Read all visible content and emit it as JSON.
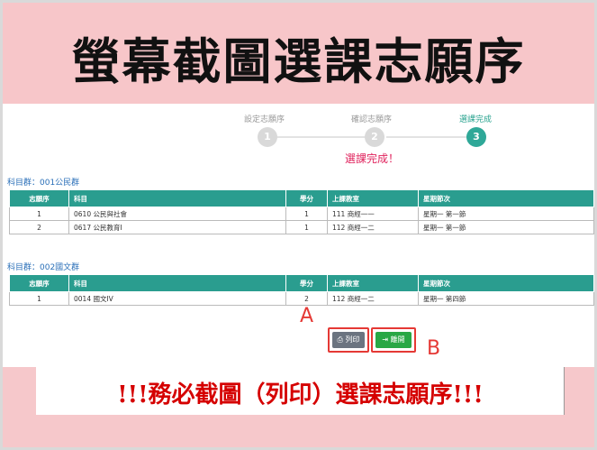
{
  "title": "螢幕截圖選課志願序",
  "steps": [
    {
      "label": "設定志願序",
      "number": "1",
      "active": false
    },
    {
      "label": "確認志願序",
      "number": "2",
      "active": false
    },
    {
      "label": "選課完成",
      "number": "3",
      "active": true
    }
  ],
  "done_message": "選課完成！",
  "columns": [
    "志願序",
    "科目",
    "學分",
    "上課教室",
    "星期節次"
  ],
  "groups": [
    {
      "label": "科目群：001公民群",
      "rows": [
        [
          "1",
          "0610 公民與社會",
          "1",
          "111 商經一一",
          "星期一 第一節"
        ],
        [
          "2",
          "0617 公民教育Ⅰ",
          "1",
          "112 商經一二",
          "星期一 第一節"
        ]
      ]
    },
    {
      "label": "科目群：002國文群",
      "rows": [
        [
          "1",
          "0014 國文IV",
          "2",
          "112 商經一二",
          "星期一 第四節"
        ]
      ]
    }
  ],
  "buttons": {
    "print": "列印",
    "leave": "離開"
  },
  "icons": {
    "print": "printer-icon",
    "leave": "exit-icon"
  },
  "markers": {
    "a": "A",
    "b": "B"
  },
  "warning": "!!!務必截圖（列印）選課志願序!!!",
  "colors": {
    "accent": "#2a9d8f",
    "highlight": "#e53935",
    "warning": "#d50000",
    "band": "#f7c6c9"
  }
}
